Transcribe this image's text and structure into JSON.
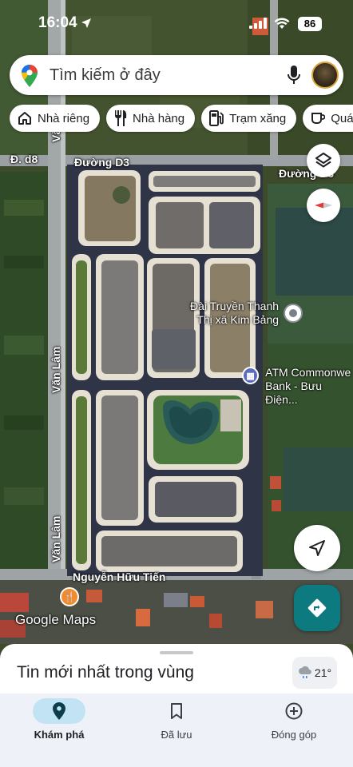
{
  "status_bar": {
    "time": "16:04",
    "battery": "86"
  },
  "search": {
    "placeholder": "Tìm kiếm ở đây"
  },
  "chips": [
    {
      "label": "Nhà riêng",
      "icon": "home-icon"
    },
    {
      "label": "Nhà hàng",
      "icon": "restaurant-icon"
    },
    {
      "label": "Trạm xăng",
      "icon": "gas-station-icon"
    },
    {
      "label": "Quán",
      "icon": "coffee-icon"
    }
  ],
  "map": {
    "labels": {
      "road_d8": "Đ. d8",
      "road_d3_left": "Đường D3",
      "road_d3_right": "Đường D3",
      "van_lam_top": "Văn",
      "van_lam_mid": "Văn Lâm",
      "van_lam_bottom": "Văn Lâm",
      "nguyen_huu_tien": "Nguyễn Hữu Tiến"
    },
    "pois": {
      "radio_station_line1": "Đài Truyền Thanh",
      "radio_station_line2": "Thị xã Kim Bảng",
      "atm_line1": "ATM Commonwe",
      "atm_line2": "Bank - Bưu Điện..."
    },
    "watermark": "Google Maps"
  },
  "sheet": {
    "title": "Tin mới nhất trong vùng",
    "temperature": "21°"
  },
  "nav": [
    {
      "label": "Khám phá",
      "icon": "explore-pin-icon",
      "active": true
    },
    {
      "label": "Đã lưu",
      "icon": "bookmark-icon",
      "active": false
    },
    {
      "label": "Đóng góp",
      "icon": "add-circle-icon",
      "active": false
    }
  ],
  "colors": {
    "accent": "#0d7a7f",
    "nav_active": "#c2e3f4",
    "compass_red": "#e53935"
  }
}
